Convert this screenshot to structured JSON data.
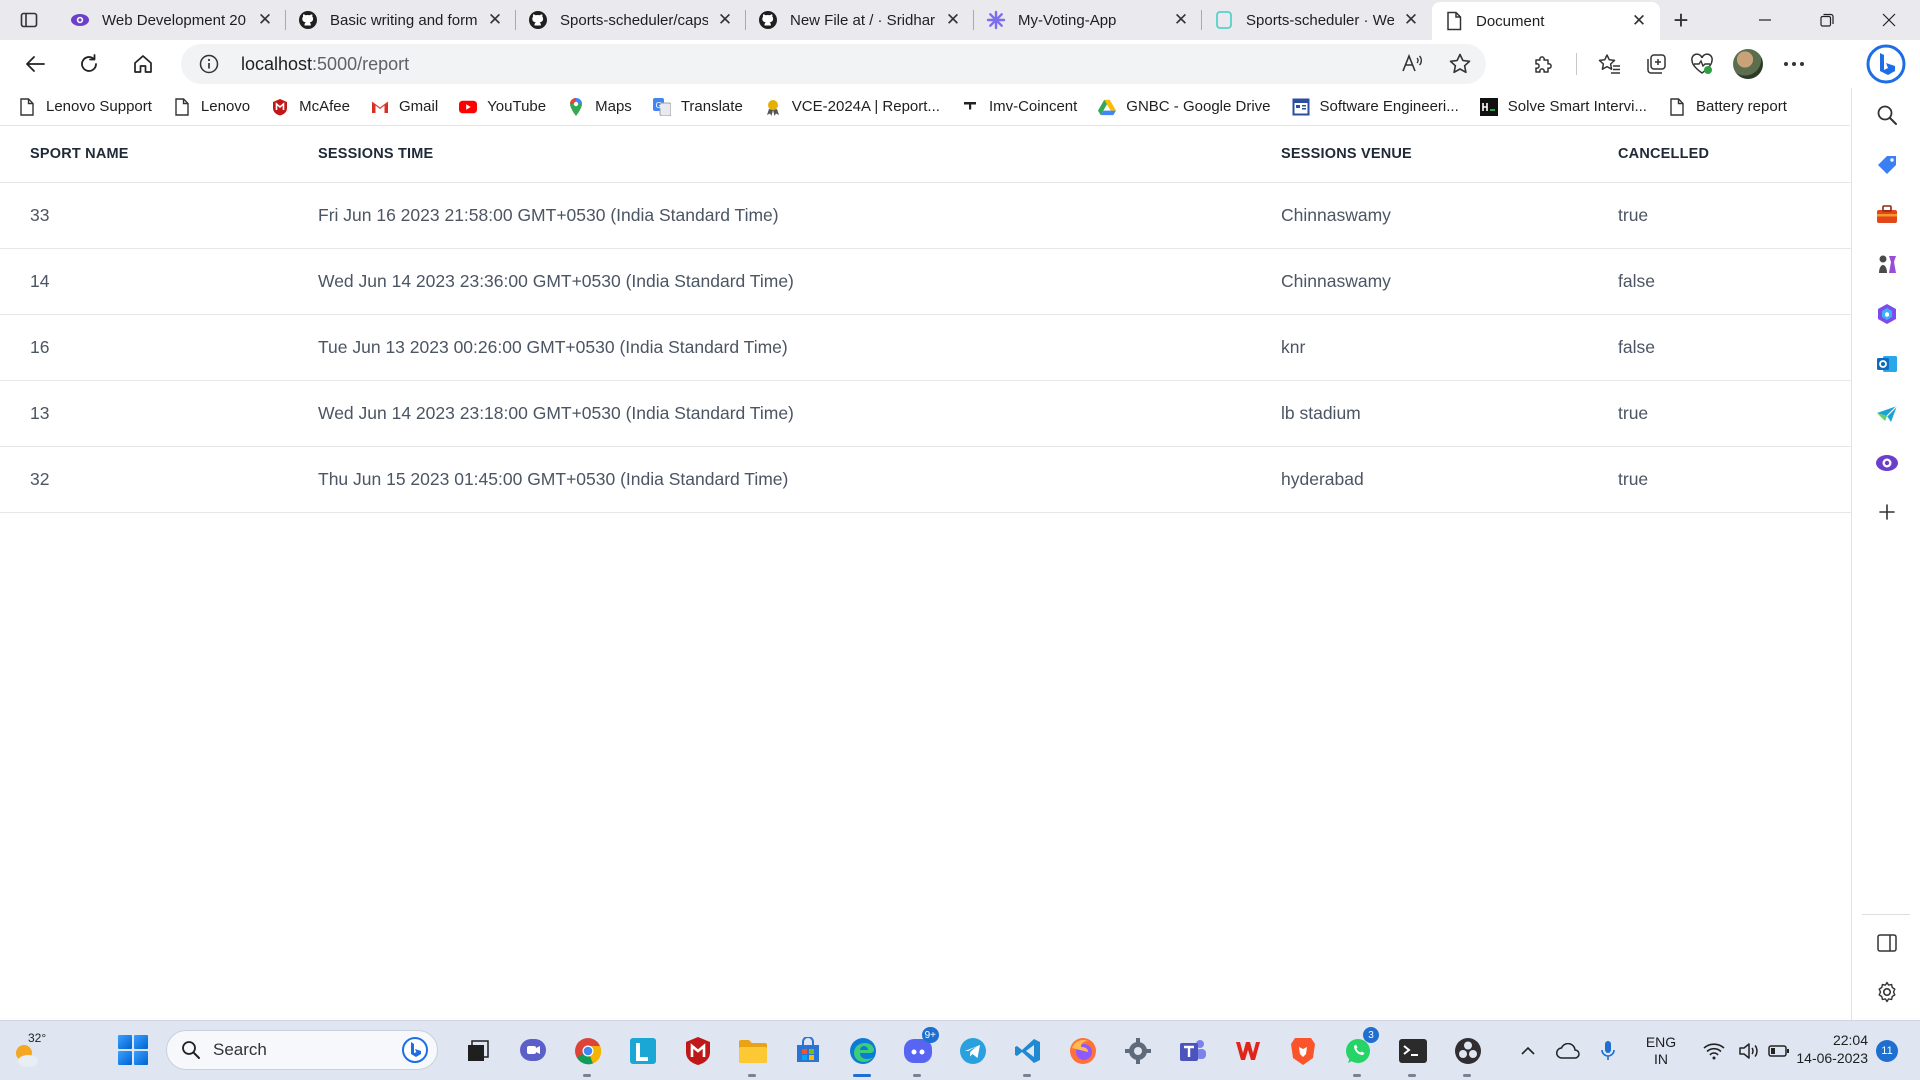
{
  "browser": {
    "tabs": [
      {
        "title": "Web Development 20",
        "icon": "eye-icon",
        "active": false
      },
      {
        "title": "Basic writing and form",
        "icon": "github-icon",
        "active": false
      },
      {
        "title": "Sports-scheduler/caps",
        "icon": "github-icon",
        "active": false
      },
      {
        "title": "New File at / · Sridhar",
        "icon": "github-icon",
        "active": false
      },
      {
        "title": "My-Voting-App",
        "icon": "asterisk-icon",
        "active": false
      },
      {
        "title": "Sports-scheduler · We",
        "icon": "page-icon",
        "active": false
      },
      {
        "title": "Document",
        "icon": "document-icon",
        "active": true
      }
    ],
    "close_glyph": "✕",
    "new_tab_glyph": "+",
    "url_host": "localhost",
    "url_path": ":5000/report"
  },
  "bookmarks": [
    {
      "label": "Lenovo Support",
      "icon": "document-icon"
    },
    {
      "label": "Lenovo",
      "icon": "document-icon"
    },
    {
      "label": "McAfee",
      "icon": "mcafee-icon"
    },
    {
      "label": "Gmail",
      "icon": "gmail-icon"
    },
    {
      "label": "YouTube",
      "icon": "youtube-icon"
    },
    {
      "label": "Maps",
      "icon": "maps-icon"
    },
    {
      "label": "Translate",
      "icon": "translate-icon"
    },
    {
      "label": "VCE-2024A | Report...",
      "icon": "award-icon"
    },
    {
      "label": "Imv-Coincent",
      "icon": "dash-icon"
    },
    {
      "label": "GNBC - Google Drive",
      "icon": "drive-icon"
    },
    {
      "label": "Software Engineeri...",
      "icon": "window-icon"
    },
    {
      "label": "Solve Smart Intervi...",
      "icon": "terminal-icon"
    },
    {
      "label": "Battery report",
      "icon": "document-icon"
    }
  ],
  "report": {
    "headers": [
      "SPORT NAME",
      "SESSIONS TIME",
      "SESSIONS VENUE",
      "CANCELLED"
    ],
    "rows": [
      [
        "33",
        "Fri Jun 16 2023 21:58:00 GMT+0530 (India Standard Time)",
        "Chinnaswamy",
        "true"
      ],
      [
        "14",
        "Wed Jun 14 2023 23:36:00 GMT+0530 (India Standard Time)",
        "Chinnaswamy",
        "false"
      ],
      [
        "16",
        "Tue Jun 13 2023 00:26:00 GMT+0530 (India Standard Time)",
        "knr",
        "false"
      ],
      [
        "13",
        "Wed Jun 14 2023 23:18:00 GMT+0530 (India Standard Time)",
        "lb stadium",
        "true"
      ],
      [
        "32",
        "Thu Jun 15 2023 01:45:00 GMT+0530 (India Standard Time)",
        "hyderabad",
        "true"
      ]
    ]
  },
  "taskbar": {
    "weather_temp": "32°",
    "search_label": "Search",
    "discord_badge": "9+",
    "whatsapp_badge": "3",
    "lang_line1": "ENG",
    "lang_line2": "IN",
    "time": "22:04",
    "date": "14-06-2023",
    "notification_count": "11"
  }
}
